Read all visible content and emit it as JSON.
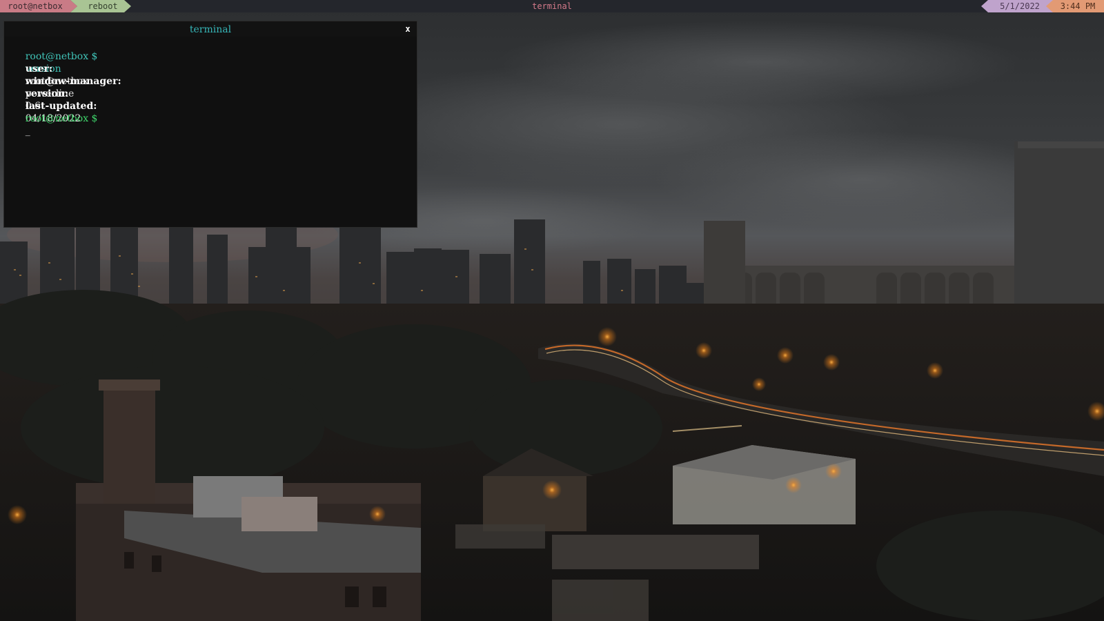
{
  "topbar": {
    "user": "root@netbox",
    "reboot": "reboot",
    "title": "terminal",
    "date": "5/1/2022",
    "time": "3:44 PM"
  },
  "terminal": {
    "title": "terminal",
    "close": "x",
    "prompt": "root@netbox $",
    "command": "version",
    "info": [
      {
        "key": "user:",
        "value": "root@netbox"
      },
      {
        "key": "window-manager:",
        "value": "powerline"
      },
      {
        "key": "version:",
        "value": "0.6"
      },
      {
        "key": "last-updated:",
        "value": "04/18/2022"
      }
    ],
    "cursor": "_"
  },
  "colors": {
    "segment_user": "#c97b86",
    "segment_reboot": "#a9c494",
    "segment_date": "#bfa3cc",
    "segment_time": "#e29a74",
    "prompt_teal": "#40c4b8",
    "prompt_green": "#3ed46a"
  }
}
